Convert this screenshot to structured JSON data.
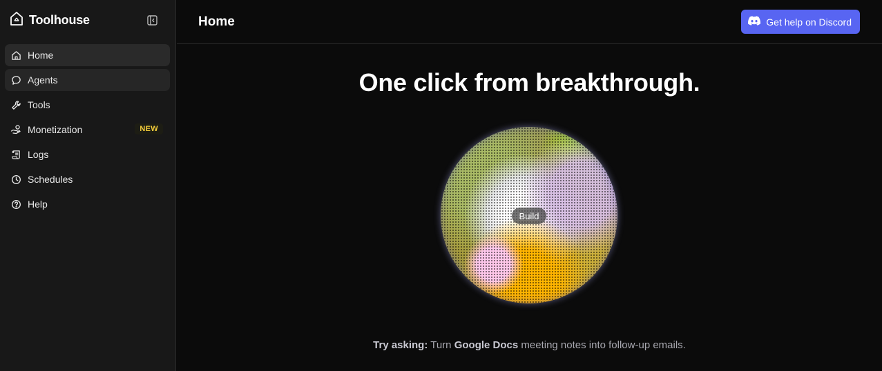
{
  "brand": {
    "name": "Toolhouse"
  },
  "sidebar": {
    "items": [
      {
        "label": "Home",
        "icon": "home-icon"
      },
      {
        "label": "Agents",
        "icon": "chat-bubble-icon"
      },
      {
        "label": "Tools",
        "icon": "wrench-icon"
      },
      {
        "label": "Monetization",
        "icon": "money-hand-icon",
        "badge": "NEW"
      },
      {
        "label": "Logs",
        "icon": "scroll-icon"
      },
      {
        "label": "Schedules",
        "icon": "clock-icon"
      },
      {
        "label": "Help",
        "icon": "help-circle-icon"
      }
    ]
  },
  "header": {
    "title": "Home",
    "discord_label": "Get help on Discord"
  },
  "main": {
    "hero": "One click from breakthrough.",
    "orb_label": "Build",
    "prompt": {
      "lead": "Try asking:",
      "part1": " Turn ",
      "highlight": "Google Docs",
      "part2": " meeting notes into follow-up emails."
    }
  },
  "colors": {
    "accent": "#5865f2",
    "badge": "#f3cc3b",
    "background": "#0b0b0b",
    "sidebar": "#181818"
  }
}
